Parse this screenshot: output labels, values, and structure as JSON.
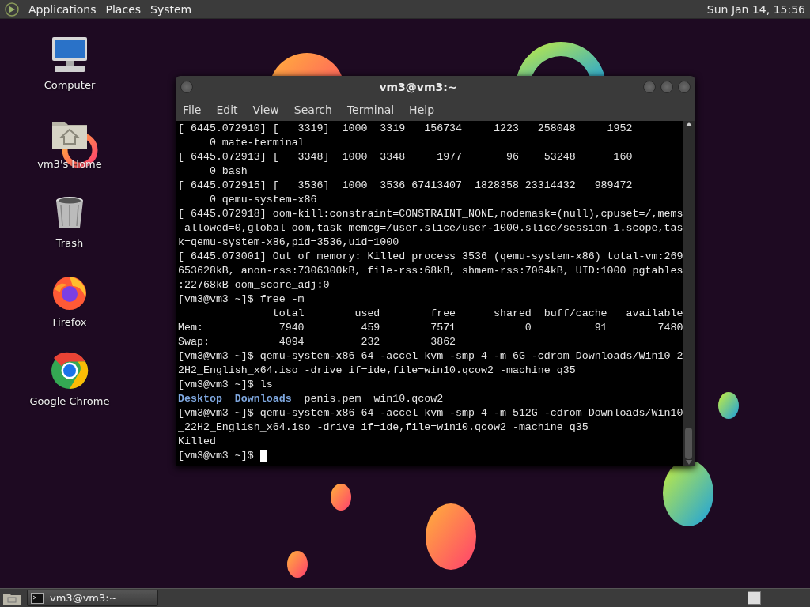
{
  "top_panel": {
    "menus": [
      "Applications",
      "Places",
      "System"
    ],
    "clock": "Sun Jan 14, 15:56"
  },
  "desktop_icons": [
    {
      "label": "Computer",
      "kind": "computer"
    },
    {
      "label": "vm3's Home",
      "kind": "home"
    },
    {
      "label": "Trash",
      "kind": "trash"
    },
    {
      "label": "Firefox",
      "kind": "firefox"
    },
    {
      "label": "Google Chrome",
      "kind": "chrome"
    }
  ],
  "terminal": {
    "title": "vm3@vm3:~",
    "menu": [
      "File",
      "Edit",
      "View",
      "Search",
      "Terminal",
      "Help"
    ],
    "lines": [
      {
        "text": "[ 6445.072910] [   3319]  1000  3319   156734     1223   258048     1952"
      },
      {
        "text": "     0 mate-terminal"
      },
      {
        "text": "[ 6445.072913] [   3348]  1000  3348     1977       96    53248      160"
      },
      {
        "text": "     0 bash"
      },
      {
        "text": "[ 6445.072915] [   3536]  1000  3536 67413407  1828358 23314432   989472"
      },
      {
        "text": "     0 qemu-system-x86"
      },
      {
        "text": "[ 6445.072918] oom-kill:constraint=CONSTRAINT_NONE,nodemask=(null),cpuset=/,mems"
      },
      {
        "text": "_allowed=0,global_oom,task_memcg=/user.slice/user-1000.slice/session-1.scope,tas"
      },
      {
        "text": "k=qemu-system-x86,pid=3536,uid=1000"
      },
      {
        "text": "[ 6445.073001] Out of memory: Killed process 3536 (qemu-system-x86) total-vm:269"
      },
      {
        "text": "653628kB, anon-rss:7306300kB, file-rss:68kB, shmem-rss:7064kB, UID:1000 pgtables"
      },
      {
        "text": ":22768kB oom_score_adj:0"
      },
      {
        "text": "[vm3@vm3 ~]$ free -m"
      },
      {
        "text": "               total        used        free      shared  buff/cache   available"
      },
      {
        "text": "Mem:            7940         459        7571           0          91        7480"
      },
      {
        "text": "Swap:           4094         232        3862"
      },
      {
        "text": "[vm3@vm3 ~]$ qemu-system-x86_64 -accel kvm -smp 4 -m 6G -cdrom Downloads/Win10_2"
      },
      {
        "text": "2H2_English_x64.iso -drive if=ide,file=win10.qcow2 -machine q35"
      },
      {
        "text": "[vm3@vm3 ~]$ ls"
      },
      {
        "items": [
          {
            "text": "Desktop",
            "kind": "directory"
          },
          {
            "text": "Downloads",
            "kind": "directory"
          },
          {
            "text": "penis.pem",
            "kind": "file"
          },
          {
            "text": "win10.qcow2",
            "kind": "file"
          }
        ]
      },
      {
        "text": "[vm3@vm3 ~]$ qemu-system-x86_64 -accel kvm -smp 4 -m 512G -cdrom Downloads/Win10"
      },
      {
        "text": "_22H2_English_x64.iso -drive if=ide,file=win10.qcow2 -machine q35"
      },
      {
        "text": "Killed"
      },
      {
        "text": "[vm3@vm3 ~]$ ",
        "cursor": true
      }
    ]
  },
  "taskbar": {
    "windows": [
      {
        "label": "vm3@vm3:~",
        "selected": false
      }
    ]
  }
}
